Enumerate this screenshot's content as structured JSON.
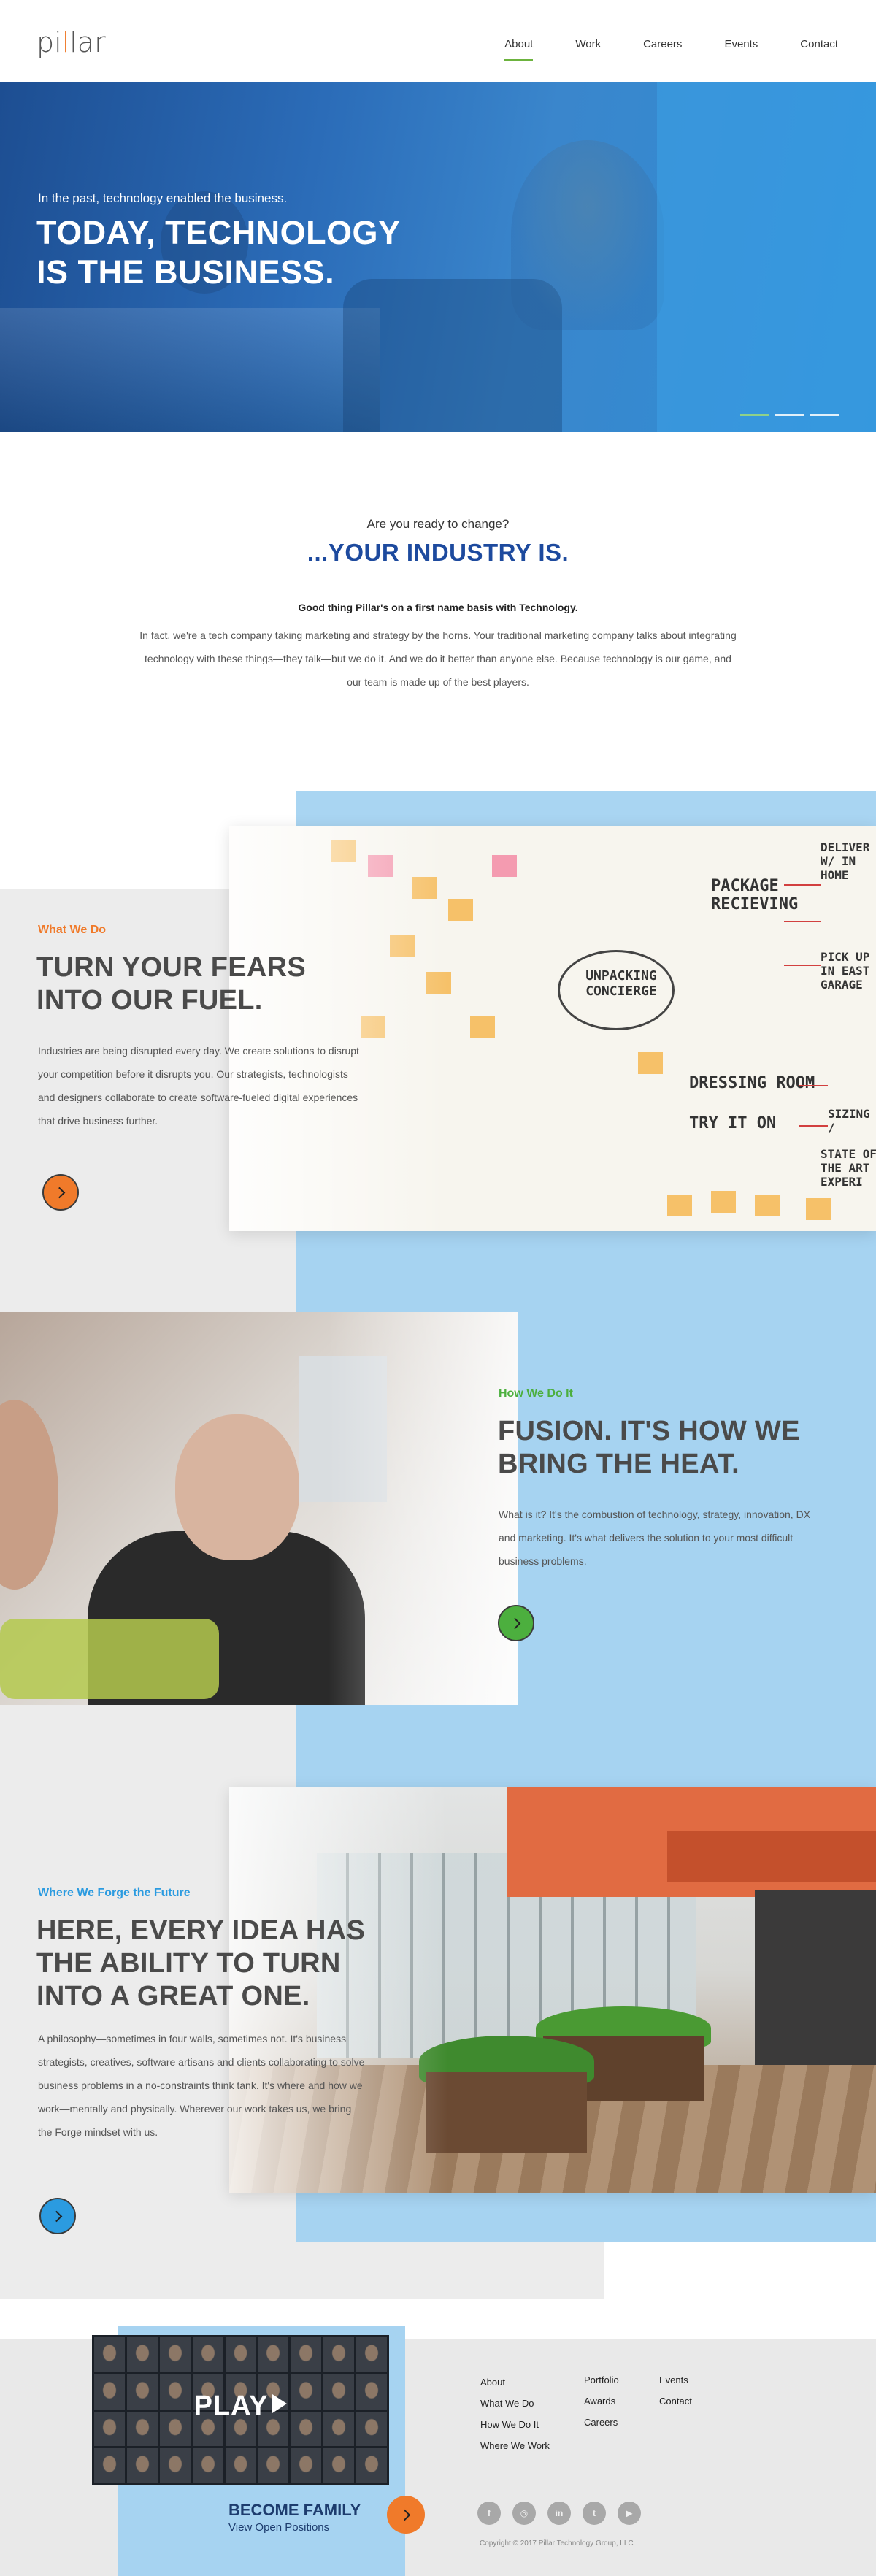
{
  "header": {
    "logo_text_a": "pi",
    "logo_text_b": "l",
    "logo_text_c": "lar",
    "nav": [
      {
        "label": "About",
        "active": true
      },
      {
        "label": "Work",
        "active": false
      },
      {
        "label": "Careers",
        "active": false
      },
      {
        "label": "Events",
        "active": false
      },
      {
        "label": "Contact",
        "active": false
      }
    ]
  },
  "hero": {
    "subtitle": "In the past, technology enabled the business.",
    "title_line1": "TODAY, TECHNOLOGY",
    "title_line2": "IS THE BUSINESS.",
    "slides": 3,
    "active_slide": 1
  },
  "intro": {
    "question": "Are you ready to change?",
    "headline": "...YOUR INDUSTRY IS.",
    "lead": "Good thing Pillar's on a first name basis with Technology.",
    "body": "In fact, we're a tech company taking marketing and strategy by the horns. Your traditional marketing company talks about integrating technology with these things—they talk—but we do it. And we do it better than anyone else. Because technology is our game, and our team is made up of the best players."
  },
  "sections": {
    "what_we_do": {
      "eyebrow": "What We Do",
      "title_line1": "TURN YOUR FEARS",
      "title_line2": "INTO OUR FUEL.",
      "text": "Industries are being disrupted every day. We create solutions to disrupt your competition before it disrupts you. Our strategists, technologists and designers collaborate to create software-fueled digital experiences that drive business further.",
      "accent": "#f07a2a",
      "whiteboard": {
        "package": "PACKAGE RECIEVING",
        "unpacking": "UNPACKING CONCIERGE",
        "dressing": "DRESSING ROOM",
        "try": "TRY IT ON",
        "deliver": "DELIVER W/ IN HOME",
        "sizing": "SIZING /",
        "pickup": "PICK UP IN EAST GARAGE",
        "state": "STATE OF THE ART EXPERI"
      }
    },
    "how_we_do_it": {
      "eyebrow": "How We Do It",
      "title_line1": "FUSION. IT'S HOW WE",
      "title_line2": "BRING THE HEAT.",
      "text": "What is it? It's the combustion of technology, strategy, innovation, DX and marketing. It's what delivers the solution to your most difficult business problems.",
      "accent": "#4caf3e"
    },
    "forge": {
      "eyebrow": "Where We Forge the Future",
      "title_line1": "HERE, EVERY IDEA HAS",
      "title_line2": "THE ABILITY TO TURN",
      "title_line3": "INTO A GREAT ONE.",
      "text": "A philosophy—sometimes in four walls, sometimes not. It's business strategists, creatives, software artisans and clients collaborating to solve business problems in a no-constraints think tank. It's where and how we work—mentally and physically. Wherever our work takes us, we bring the Forge mindset with us.",
      "accent": "#2b9be0"
    }
  },
  "footer": {
    "video_label": "PLAY",
    "family_title": "BECOME FAMILY",
    "family_sub": "View Open Positions",
    "col1": [
      "About",
      "What We Do",
      "How We Do It",
      "Where We Work"
    ],
    "col2": [
      "Portfolio",
      "Awards",
      "Careers"
    ],
    "col3": [
      "Events",
      "Contact"
    ],
    "socials": [
      {
        "icon": "facebook-icon",
        "glyph": "f"
      },
      {
        "icon": "instagram-icon",
        "glyph": "◎"
      },
      {
        "icon": "linkedin-icon",
        "glyph": "in"
      },
      {
        "icon": "twitter-icon",
        "glyph": "t"
      },
      {
        "icon": "youtube-icon",
        "glyph": "▶"
      }
    ],
    "copyright": "Copyright © 2017 Pillar Technology Group, LLC"
  }
}
